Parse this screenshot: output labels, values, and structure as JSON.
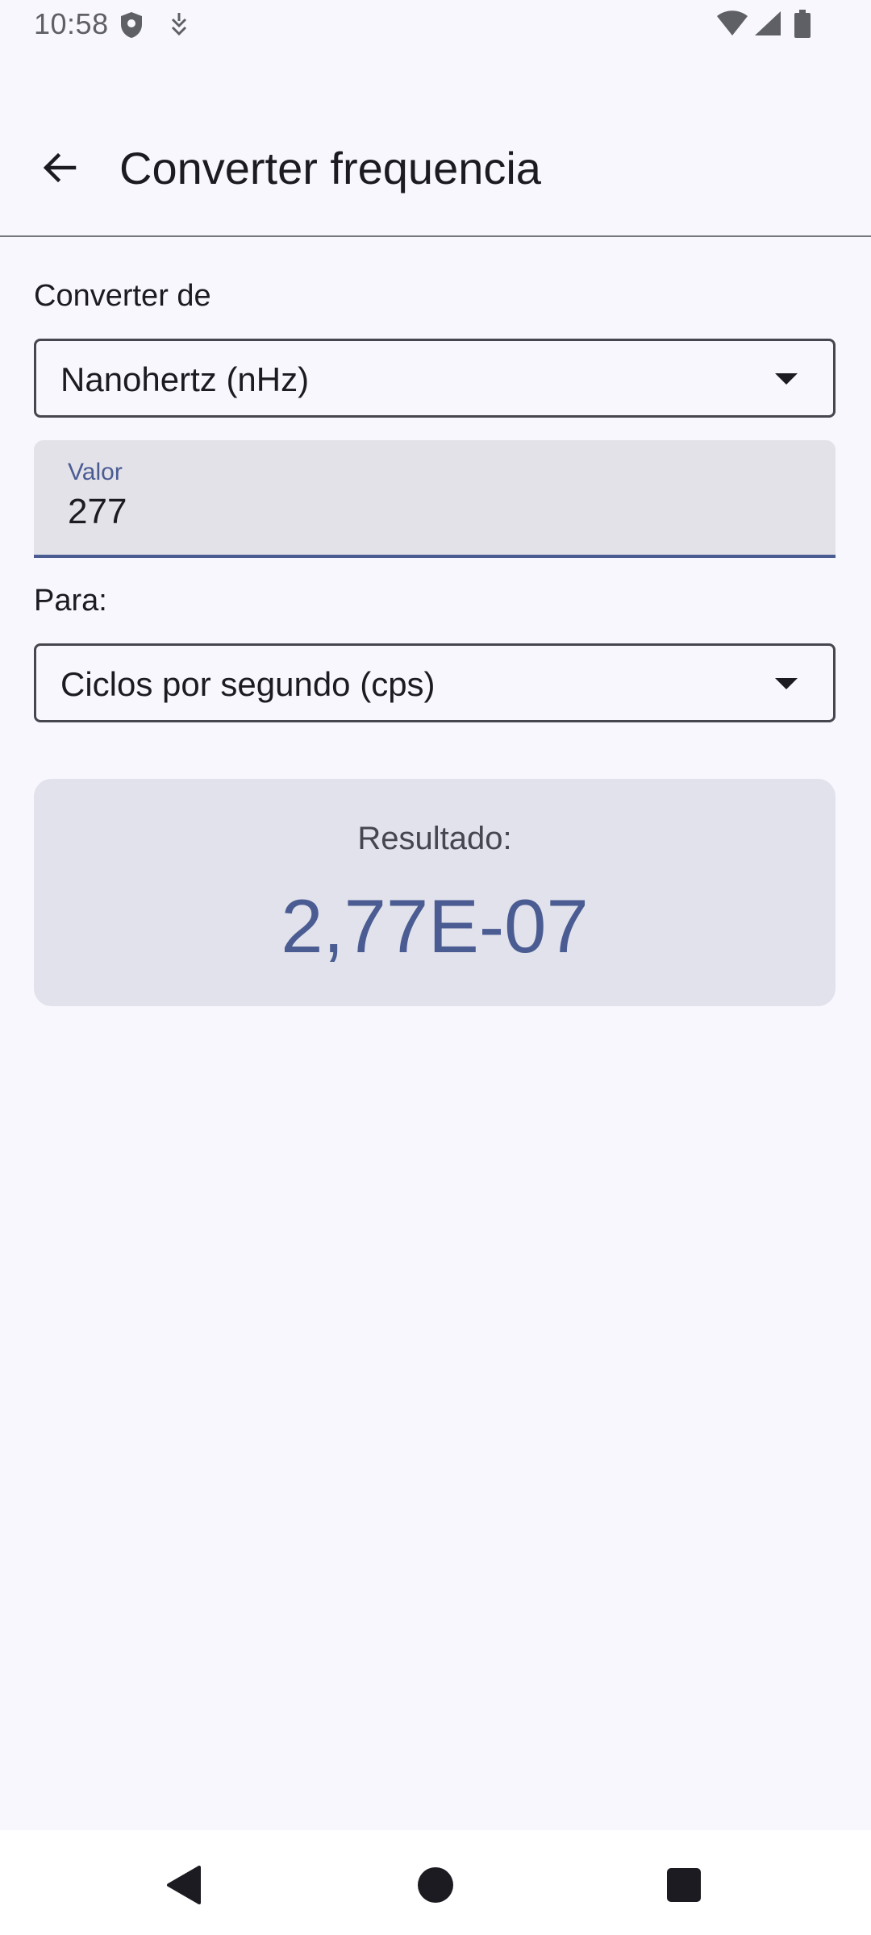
{
  "status_bar": {
    "time": "10:58",
    "icons": [
      "shield-icon",
      "debug-icon",
      "wifi-icon",
      "signal-icon",
      "battery-icon"
    ]
  },
  "app_bar": {
    "back_icon": "arrow-back-icon",
    "title": "Converter frequencia"
  },
  "form": {
    "from_label": "Converter de",
    "from_unit": "Nanohertz (nHz)",
    "value_label": "Valor",
    "value": "277",
    "to_label": "Para:",
    "to_unit": "Ciclos por segundo (cps)"
  },
  "result": {
    "label": "Resultado:",
    "value": "2,77E-07"
  },
  "nav_bar": {
    "icons": [
      "nav-back-icon",
      "nav-home-icon",
      "nav-recents-icon"
    ]
  },
  "colors": {
    "background": "#f8f7fe",
    "accent": "#4a5c92",
    "field_fill": "#e3e2e9",
    "result_fill": "#e2e2ec"
  }
}
